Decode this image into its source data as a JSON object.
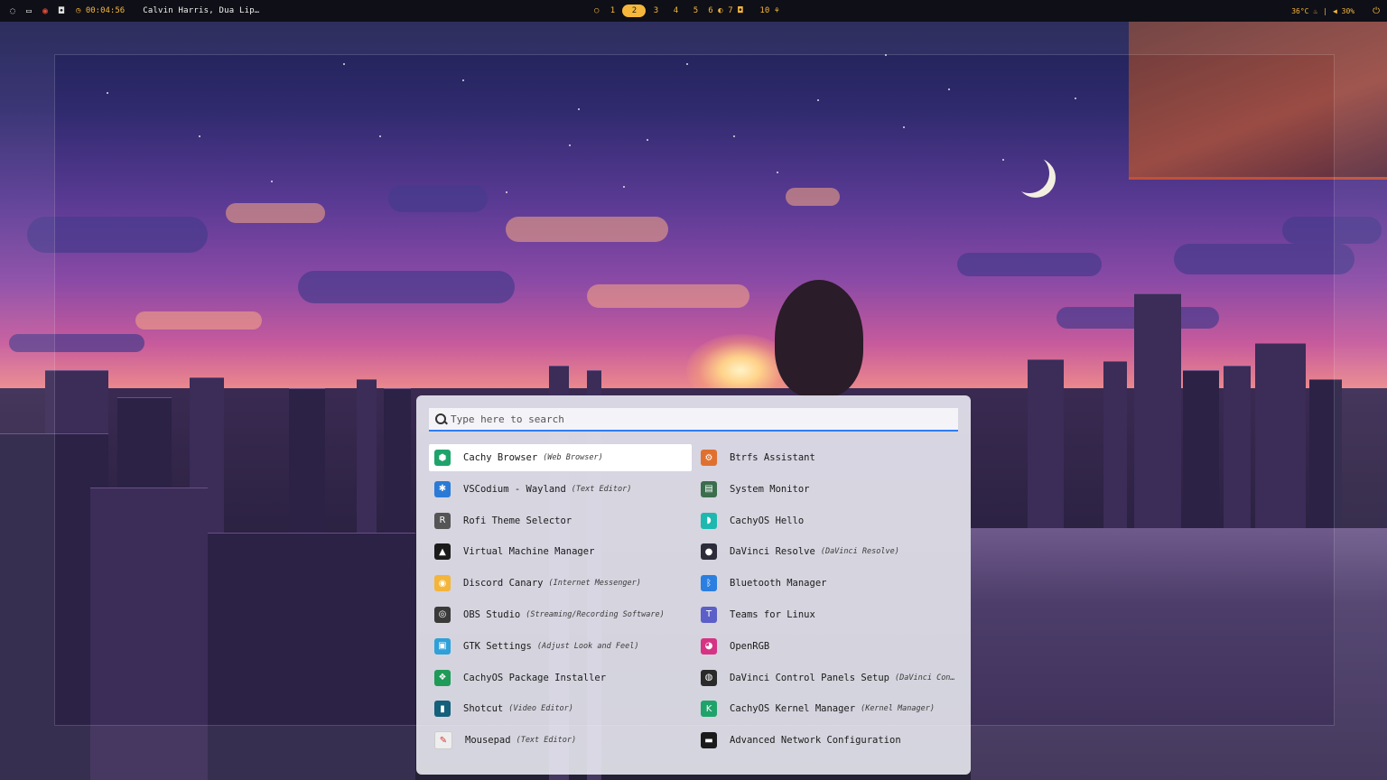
{
  "colors": {
    "accent": "#f5b73b",
    "search_focus": "#2f7cf6",
    "launcher_bg": "#eeeef6",
    "topbar_bg": "#0f0f17"
  },
  "topbar": {
    "left_icons": [
      "eye-off-icon",
      "monitor-icon",
      "chrome-icon",
      "discord-icon"
    ],
    "timer": "00:04:56",
    "track": "Calvin Harris, Dua Lip…",
    "workspaces": [
      {
        "label": "1",
        "active": false
      },
      {
        "label": "2",
        "active": true
      },
      {
        "label": "3",
        "active": false
      },
      {
        "label": "4",
        "active": false
      },
      {
        "label": "5",
        "active": false
      },
      {
        "label": "6 ◐",
        "active": false
      },
      {
        "label": "7 ◘",
        "active": false
      },
      {
        "label": "10 ⚘",
        "active": false
      }
    ],
    "temperature": "36°C",
    "volume": "30%",
    "power_icon": "power-icon"
  },
  "launcher": {
    "search": {
      "placeholder": "Type here to search",
      "value": ""
    },
    "entries": [
      {
        "name": "Cachy Browser",
        "desc": "(Web Browser)",
        "icon": "cachy-browser-icon",
        "color": "#1fa36b",
        "glyph": "⬢",
        "selected": true
      },
      {
        "name": "Btrfs Assistant",
        "desc": "",
        "icon": "btrfs-assistant-icon",
        "color": "#e0702f",
        "glyph": "⚙",
        "selected": false
      },
      {
        "name": "VSCodium - Wayland",
        "desc": "(Text Editor)",
        "icon": "vscodium-icon",
        "color": "#2b7bd6",
        "glyph": "✱",
        "selected": false
      },
      {
        "name": "System Monitor",
        "desc": "",
        "icon": "system-monitor-icon",
        "color": "#3a6e4c",
        "glyph": "▤",
        "selected": false
      },
      {
        "name": "Rofi Theme Selector",
        "desc": "",
        "icon": "rofi-theme-icon",
        "color": "#555555",
        "glyph": "R",
        "selected": false
      },
      {
        "name": "CachyOS Hello",
        "desc": "",
        "icon": "cachyos-hello-icon",
        "color": "#1fb8b0",
        "glyph": "◗",
        "selected": false
      },
      {
        "name": "Virtual Machine Manager",
        "desc": "",
        "icon": "virt-manager-icon",
        "color": "#1b1b1b",
        "glyph": "▲",
        "selected": false
      },
      {
        "name": "DaVinci Resolve",
        "desc": "(DaVinci Resolve)",
        "icon": "davinci-resolve-icon",
        "color": "#2c2c3a",
        "glyph": "●",
        "selected": false
      },
      {
        "name": "Discord Canary",
        "desc": "(Internet Messenger)",
        "icon": "discord-canary-icon",
        "color": "#f3b53a",
        "glyph": "◉",
        "selected": false
      },
      {
        "name": "Bluetooth Manager",
        "desc": "",
        "icon": "bluetooth-icon",
        "color": "#2a7fe0",
        "glyph": "ᛒ",
        "selected": false
      },
      {
        "name": "OBS Studio",
        "desc": "(Streaming/Recording Software)",
        "icon": "obs-studio-icon",
        "color": "#3a3a3a",
        "glyph": "◎",
        "selected": false
      },
      {
        "name": "Teams for Linux",
        "desc": "",
        "icon": "teams-icon",
        "color": "#5b5fc7",
        "glyph": "T",
        "selected": false
      },
      {
        "name": "GTK Settings",
        "desc": "(Adjust Look and Feel)",
        "icon": "gtk-settings-icon",
        "color": "#2fa0d8",
        "glyph": "▣",
        "selected": false
      },
      {
        "name": "OpenRGB",
        "desc": "",
        "icon": "openrgb-icon",
        "color": "#d63384",
        "glyph": "◕",
        "selected": false
      },
      {
        "name": "CachyOS Package Installer",
        "desc": "",
        "icon": "package-installer-icon",
        "color": "#1f9a58",
        "glyph": "❖",
        "selected": false
      },
      {
        "name": "DaVinci Control Panels Setup",
        "desc": "(DaVinci Contr…",
        "icon": "davinci-panels-icon",
        "color": "#2a2a2a",
        "glyph": "◍",
        "selected": false
      },
      {
        "name": "Shotcut",
        "desc": "(Video Editor)",
        "icon": "shotcut-icon",
        "color": "#15607a",
        "glyph": "▮",
        "selected": false
      },
      {
        "name": "CachyOS Kernel Manager",
        "desc": "(Kernel Manager)",
        "icon": "kernel-manager-icon",
        "color": "#1fa36b",
        "glyph": "K",
        "selected": false
      },
      {
        "name": "Mousepad",
        "desc": "(Text Editor)",
        "icon": "mousepad-icon",
        "color": "#eeeeee",
        "glyph": "✎",
        "selected": false
      },
      {
        "name": "Advanced Network Configuration",
        "desc": "",
        "icon": "network-config-icon",
        "color": "#1b1b1b",
        "glyph": "▬",
        "selected": false
      }
    ]
  }
}
